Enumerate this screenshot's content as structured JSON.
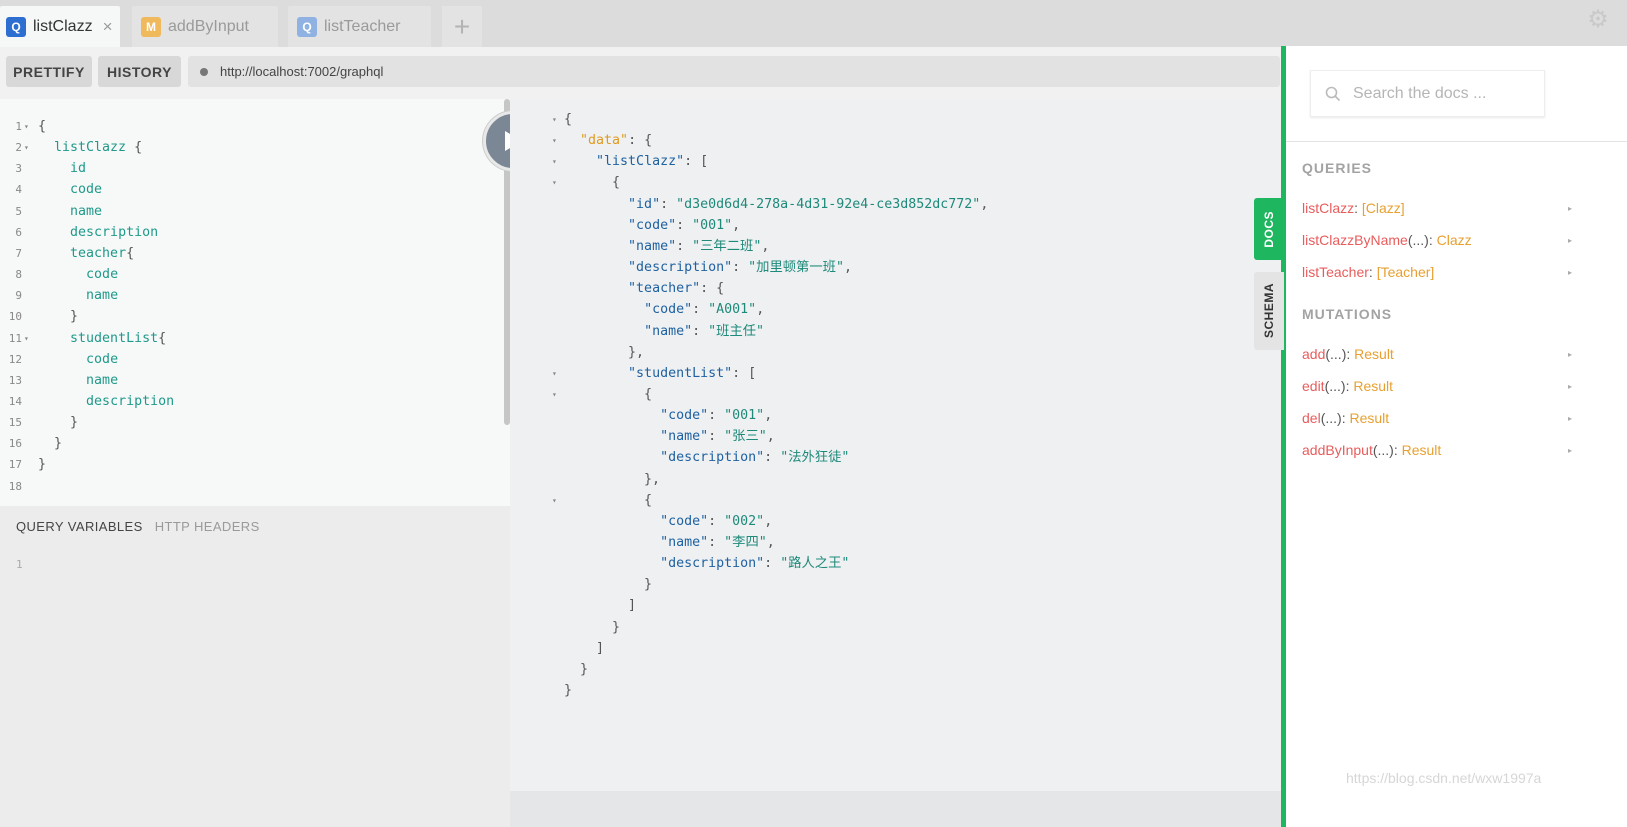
{
  "tabs": [
    {
      "badge": "Q",
      "label": "listClazz",
      "close": "×"
    },
    {
      "badge": "M",
      "label": "addByInput"
    },
    {
      "badge": "Q",
      "label": "listTeacher"
    }
  ],
  "add_tab_symbol": "+",
  "settings_icon": "⚙",
  "toolbar": {
    "prettify": "PRETTIFY",
    "history": "HISTORY",
    "url": "http://localhost:7002/graphql"
  },
  "editor": {
    "lines": [
      {
        "n": "1",
        "text": "{",
        "fold": "▾"
      },
      {
        "n": "2",
        "text": "  listClazz {",
        "fold": "▾"
      },
      {
        "n": "3",
        "text": "    id",
        "fold": ""
      },
      {
        "n": "4",
        "text": "    code",
        "fold": ""
      },
      {
        "n": "5",
        "text": "    name",
        "fold": ""
      },
      {
        "n": "6",
        "text": "    description",
        "fold": ""
      },
      {
        "n": "7",
        "text": "    teacher{",
        "fold": ""
      },
      {
        "n": "8",
        "text": "      code",
        "fold": ""
      },
      {
        "n": "9",
        "text": "      name",
        "fold": ""
      },
      {
        "n": "10",
        "text": "    }",
        "fold": ""
      },
      {
        "n": "11",
        "text": "    studentList{",
        "fold": "▾"
      },
      {
        "n": "12",
        "text": "      code",
        "fold": ""
      },
      {
        "n": "13",
        "text": "      name",
        "fold": ""
      },
      {
        "n": "14",
        "text": "      description",
        "fold": ""
      },
      {
        "n": "15",
        "text": "    }",
        "fold": ""
      },
      {
        "n": "16",
        "text": "  }",
        "fold": ""
      },
      {
        "n": "17",
        "text": "}",
        "fold": ""
      },
      {
        "n": "18",
        "text": "",
        "fold": ""
      }
    ]
  },
  "variables": {
    "tab_active": "QUERY VARIABLES",
    "tab_other": "HTTP HEADERS",
    "line_number": "1"
  },
  "result": {
    "lines": [
      {
        "text": "{",
        "fold": "▾"
      },
      {
        "text": "  \"data\": {",
        "fold": "▾"
      },
      {
        "text": "    \"listClazz\": [",
        "fold": "▾"
      },
      {
        "text": "      {",
        "fold": "▾"
      },
      {
        "text": "        \"id\": \"d3e0d6d4-278a-4d31-92e4-ce3d852dc772\",",
        "fold": ""
      },
      {
        "text": "        \"code\": \"001\",",
        "fold": ""
      },
      {
        "text": "        \"name\": \"三年二班\",",
        "fold": ""
      },
      {
        "text": "        \"description\": \"加里顿第一班\",",
        "fold": ""
      },
      {
        "text": "        \"teacher\": {",
        "fold": ""
      },
      {
        "text": "          \"code\": \"A001\",",
        "fold": ""
      },
      {
        "text": "          \"name\": \"班主任\"",
        "fold": ""
      },
      {
        "text": "        },",
        "fold": ""
      },
      {
        "text": "        \"studentList\": [",
        "fold": "▾"
      },
      {
        "text": "          {",
        "fold": "▾"
      },
      {
        "text": "            \"code\": \"001\",",
        "fold": ""
      },
      {
        "text": "            \"name\": \"张三\",",
        "fold": ""
      },
      {
        "text": "            \"description\": \"法外狂徒\"",
        "fold": ""
      },
      {
        "text": "          },",
        "fold": ""
      },
      {
        "text": "          {",
        "fold": "▾"
      },
      {
        "text": "            \"code\": \"002\",",
        "fold": ""
      },
      {
        "text": "            \"name\": \"李四\",",
        "fold": ""
      },
      {
        "text": "            \"description\": \"路人之王\"",
        "fold": ""
      },
      {
        "text": "          }",
        "fold": ""
      },
      {
        "text": "        ]",
        "fold": ""
      },
      {
        "text": "      }",
        "fold": ""
      },
      {
        "text": "    ]",
        "fold": ""
      },
      {
        "text": "  }",
        "fold": ""
      },
      {
        "text": "}",
        "fold": ""
      }
    ]
  },
  "side_tabs": {
    "docs": "DOCS",
    "schema": "SCHEMA"
  },
  "docs": {
    "search_placeholder": "Search the docs ...",
    "queries_title": "QUERIES",
    "queries": [
      {
        "name": "listClazz",
        "args": "",
        "sep": ": ",
        "type": "[Clazz]"
      },
      {
        "name": "listClazzByName",
        "args": "(...)",
        "sep": ": ",
        "type": "Clazz"
      },
      {
        "name": "listTeacher",
        "args": "",
        "sep": ": ",
        "type": "[Teacher]"
      }
    ],
    "mutations_title": "MUTATIONS",
    "mutations": [
      {
        "name": "add",
        "args": "(...)",
        "sep": ": ",
        "type": "Result"
      },
      {
        "name": "edit",
        "args": "(...)",
        "sep": ": ",
        "type": "Result"
      },
      {
        "name": "del",
        "args": "(...)",
        "sep": ": ",
        "type": "Result"
      },
      {
        "name": "addByInput",
        "args": "(...)",
        "sep": ": ",
        "type": "Result"
      }
    ],
    "arrow": "▸",
    "watermark": "https://blog.csdn.net/wxw1997a"
  },
  "colors": {
    "accent_green": "#1fb660",
    "query_badge": "#2d6fd0",
    "mutation_badge": "#f0b95c",
    "doc_name": "#e85c5c",
    "doc_type": "#e8a030"
  }
}
